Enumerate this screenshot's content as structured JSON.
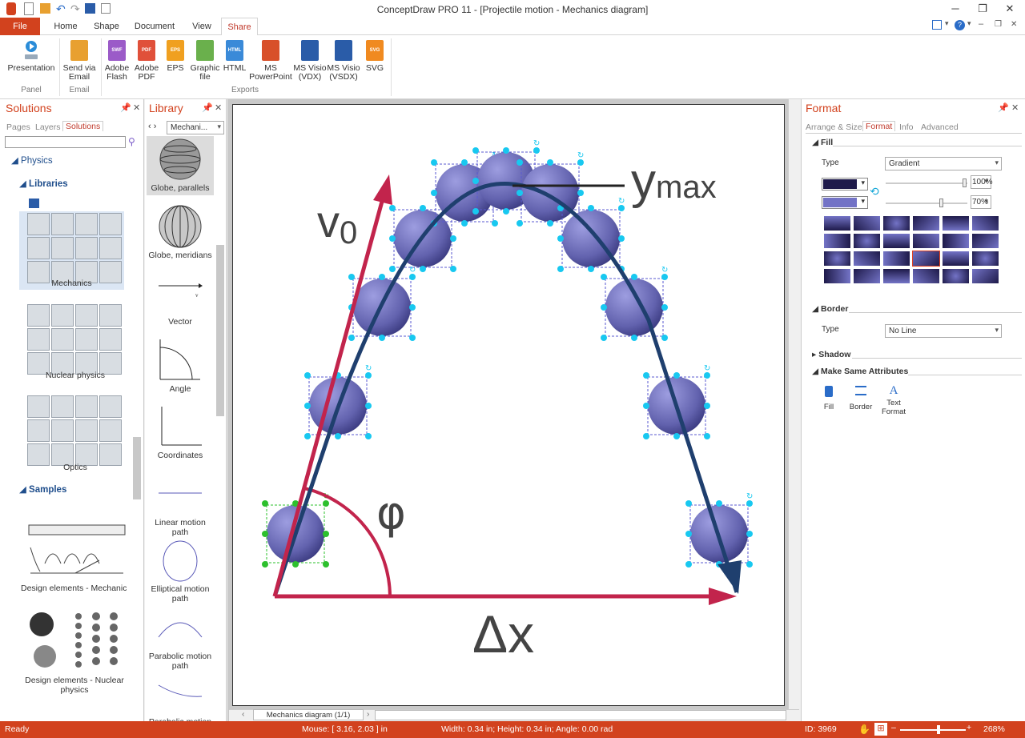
{
  "window": {
    "title": "ConceptDraw PRO 11 - [Projectile motion - Mechanics diagram]"
  },
  "ribbon": {
    "tabs": [
      "File",
      "Home",
      "Shape",
      "Document",
      "View",
      "Share"
    ],
    "buttons": {
      "presentation": "Presentation",
      "send_email": "Send via Email",
      "adobe_flash": "Adobe Flash",
      "adobe_pdf": "Adobe PDF",
      "eps": "EPS",
      "graphic_file": "Graphic file",
      "html": "HTML",
      "ms_powerpoint": "MS PowerPoint",
      "visio_vdx": "MS Visio (VDX)",
      "visio_vsdx": "MS Visio (VSDX)",
      "svg": "SVG"
    },
    "icon_badges": {
      "swf": "SWF",
      "pdf": "PDF",
      "eps": "EPS",
      "html": "HTML",
      "svg": "SVG"
    },
    "groups": {
      "panel": "Panel",
      "email": "Email",
      "exports": "Exports"
    }
  },
  "solutions": {
    "title": "Solutions",
    "tabs": [
      "Pages",
      "Layers",
      "Solutions"
    ],
    "search_value": "",
    "tree": {
      "physics": "Physics",
      "libraries": "Libraries",
      "samples": "Samples"
    },
    "libraries": [
      "Mechanics",
      "Nuclear physics",
      "Optics"
    ],
    "samples": [
      "Design elements - Mechanics",
      "Design elements - Nuclear physics"
    ]
  },
  "library": {
    "title": "Library",
    "dropdown": "Mechani...",
    "items": [
      "Globe, parallels",
      "Globe, meridians",
      "Vector",
      "Angle",
      "Coordinates",
      "Linear motion path",
      "Elliptical motion path",
      "Parabolic motion path",
      "Parabolic motion"
    ]
  },
  "canvas": {
    "labels": {
      "v0": "v",
      "v0_sub": "0",
      "ymax": "y",
      "ymax_sub": "max",
      "phi": "φ",
      "dx": "Δx"
    },
    "page_tab": "Mechanics diagram (1/1)",
    "colors": {
      "vector_red": "#c2244c",
      "path_blue": "#1f3f6e",
      "ball": "#6e6eb8",
      "handle": "#18c8f0",
      "select_green": "#2dc02d"
    }
  },
  "format": {
    "title": "Format",
    "tabs": [
      "Arrange & Size",
      "Format",
      "Info",
      "Advanced"
    ],
    "fill": {
      "header": "Fill",
      "type_label": "Type",
      "type_value": "Gradient",
      "opacity1": "100%",
      "opacity2": "70%",
      "color1": "#1e1a4a",
      "color2": "#7373c6"
    },
    "border": {
      "header": "Border",
      "type_label": "Type",
      "type_value": "No Line"
    },
    "shadow": {
      "header": "Shadow"
    },
    "same_attr": {
      "header": "Make Same Attributes",
      "fill": "Fill",
      "border": "Border",
      "text_format": "Text Format"
    }
  },
  "status": {
    "ready": "Ready",
    "mouse": "Mouse: [ 3.16, 2.03 ] in",
    "dims": "Width: 0.34 in;  Height: 0.34 in;  Angle: 0.00 rad",
    "id": "ID: 3969",
    "zoom": "268%"
  }
}
